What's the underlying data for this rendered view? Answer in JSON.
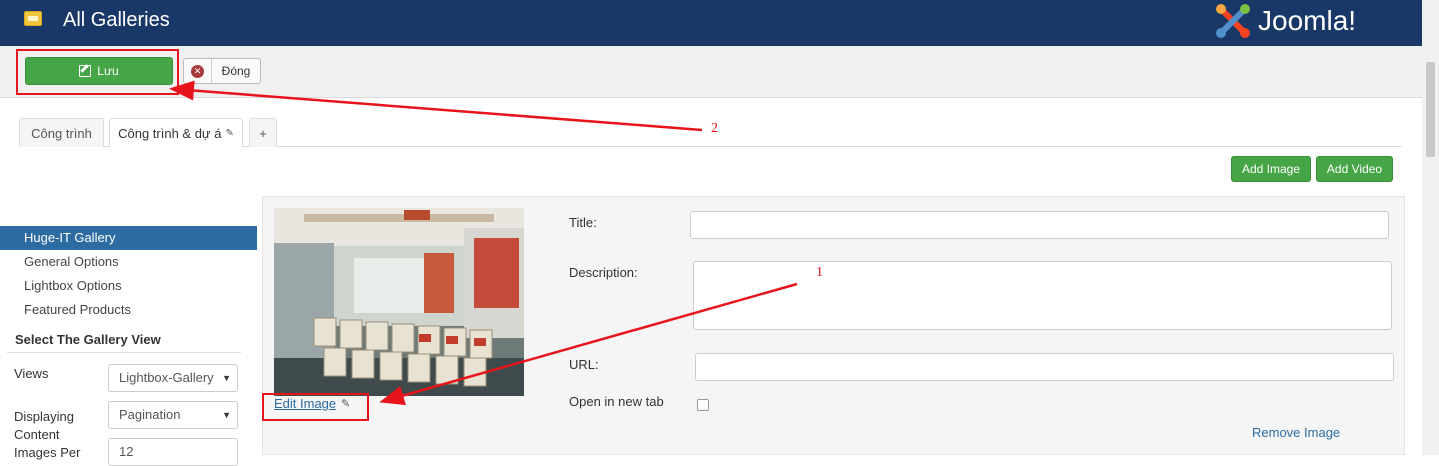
{
  "header": {
    "title": "All Galleries",
    "brand": "Joomla!"
  },
  "toolbar": {
    "save_label": "Lưu",
    "close_label": "Đóng"
  },
  "tabs": [
    {
      "label": "Công trình"
    },
    {
      "label": "Công trình & dự á"
    },
    {
      "label": "+"
    }
  ],
  "actions": {
    "add_image": "Add Image",
    "add_video": "Add Video"
  },
  "sidebar": {
    "items": [
      {
        "label": "Huge-IT Gallery",
        "active": true
      },
      {
        "label": "General Options"
      },
      {
        "label": "Lightbox Options"
      },
      {
        "label": "Featured Products"
      }
    ],
    "heading": "Select The Gallery View",
    "views_label": "Views",
    "views_value": "Lightbox-Gallery",
    "displaying_label_1": "Displaying",
    "displaying_label_2": "Content",
    "displaying_value": "Pagination",
    "images_per_label": "Images Per",
    "images_per_value": "12"
  },
  "image_item": {
    "edit_image_label": "Edit Image",
    "title_label": "Title:",
    "title_value": "",
    "description_label": "Description:",
    "description_value": "",
    "url_label": "URL:",
    "url_value": "",
    "open_new_tab_label": "Open in new tab",
    "remove_label": "Remove Image"
  },
  "annotations": {
    "marker_1": "1",
    "marker_2": "2"
  },
  "colors": {
    "header": "#1a3867",
    "accent_green": "#46a546",
    "sidebar_active": "#2d6ca2",
    "annotation_red": "#e8141b"
  }
}
